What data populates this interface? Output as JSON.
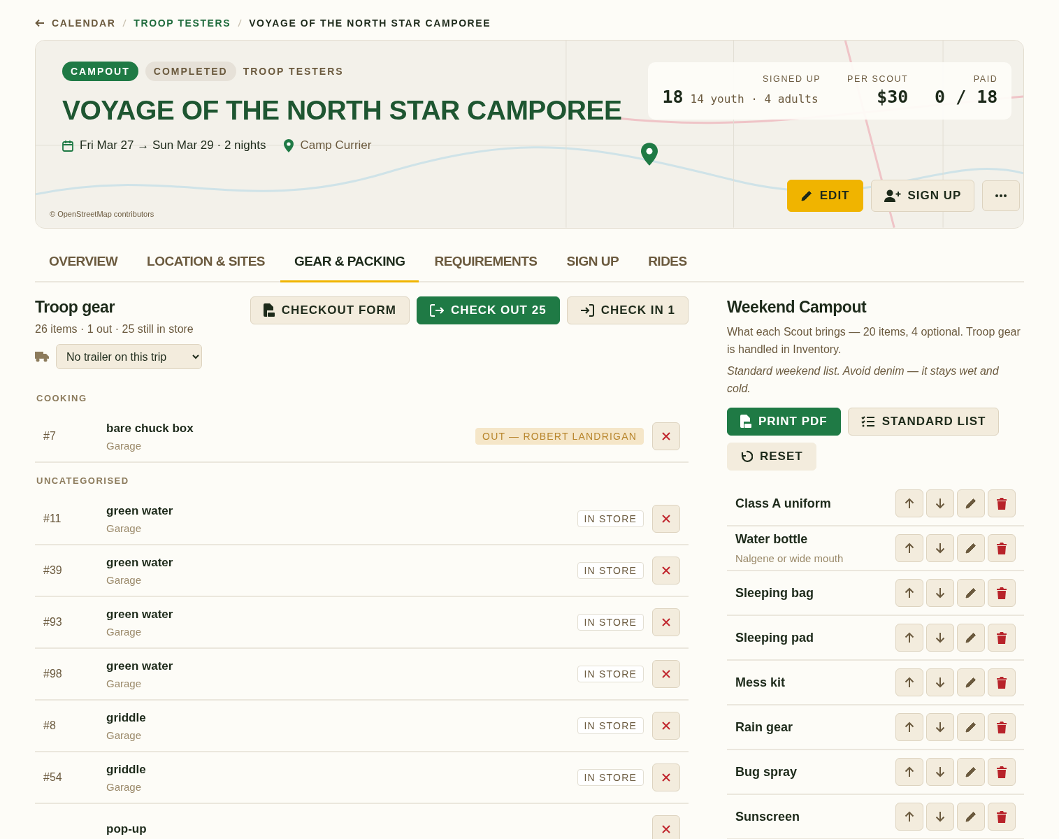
{
  "breadcrumb": [
    {
      "label": "CALENDAR",
      "kind": "back"
    },
    {
      "label": "TROOP TESTERS",
      "kind": "link"
    },
    {
      "label": "VOYAGE OF THE NORTH STAR CAMPOREE",
      "kind": "current"
    }
  ],
  "event": {
    "tags": [
      {
        "label": "CAMPOUT",
        "kind": "type"
      },
      {
        "label": "COMPLETED",
        "kind": "status"
      },
      {
        "label": "TROOP TESTERS",
        "kind": "unit"
      }
    ],
    "title": "VOYAGE OF THE NORTH STAR CAMPOREE",
    "dates": "Fri Mar 27 → Sun Mar 29 · 2 nights",
    "location": "Camp Currier",
    "map_credit": "© OpenStreetMap contributors",
    "stats": {
      "signed_up_label": "SIGNED UP",
      "signed_up": "18",
      "signed_up_detail": "14 youth · 4 adults",
      "per_scout_label": "PER SCOUT",
      "per_scout": "$30",
      "paid_label": "PAID",
      "paid": "0 / 18"
    },
    "actions": [
      {
        "label": "EDIT",
        "kind": "edit"
      },
      {
        "label": "SIGN UP",
        "kind": "signup"
      },
      {
        "kind": "more"
      }
    ]
  },
  "tabs": [
    {
      "label": "OVERVIEW",
      "selected": false
    },
    {
      "label": "LOCATION & SITES",
      "selected": false
    },
    {
      "label": "GEAR & PACKING",
      "selected": true
    },
    {
      "label": "REQUIREMENTS",
      "selected": false
    },
    {
      "label": "SIGN UP",
      "selected": false
    },
    {
      "label": "RIDES",
      "selected": false
    }
  ],
  "troop_gear": {
    "title": "Troop gear",
    "summary": "26 items · 1 out · 25 still in store",
    "trailer": "No trailer on this trip",
    "buttons": [
      {
        "label": "CHECKOUT FORM",
        "kind": "form"
      },
      {
        "label": "CHECK OUT 25",
        "kind": "checkout"
      },
      {
        "label": "CHECK IN 1",
        "kind": "checkin"
      }
    ],
    "categories": [
      {
        "name": "COOKING",
        "items": [
          {
            "number": "#7",
            "name": "bare chuck box",
            "location": "Garage",
            "status": "OUT — ROBERT LANDRIGAN",
            "kind": "out"
          }
        ]
      },
      {
        "name": "UNCATEGORISED",
        "items": [
          {
            "number": "#11",
            "name": "green water",
            "location": "Garage",
            "status": "IN STORE",
            "kind": "in_store"
          },
          {
            "number": "#39",
            "name": "green water",
            "location": "Garage",
            "status": "IN STORE",
            "kind": "in_store"
          },
          {
            "number": "#93",
            "name": "green water",
            "location": "Garage",
            "status": "IN STORE",
            "kind": "in_store"
          },
          {
            "number": "#98",
            "name": "green water",
            "location": "Garage",
            "status": "IN STORE",
            "kind": "in_store"
          },
          {
            "number": "#8",
            "name": "griddle",
            "location": "Garage",
            "status": "IN STORE",
            "kind": "in_store"
          },
          {
            "number": "#54",
            "name": "griddle",
            "location": "Garage",
            "status": "IN STORE",
            "kind": "in_store"
          },
          {
            "name": "pop-up"
          }
        ]
      }
    ]
  },
  "packing_list": {
    "title": "Weekend Campout",
    "description": "What each Scout brings — 20 items, 4 optional. Troop gear is handled in Inventory.",
    "note": "Standard weekend list. Avoid denim — it stays wet and cold.",
    "buttons": [
      {
        "label": "PRINT PDF",
        "kind": "pdf"
      },
      {
        "label": "STANDARD LIST",
        "kind": "list"
      },
      {
        "label": "RESET",
        "kind": "reset"
      }
    ],
    "items": [
      {
        "name": "Class A uniform"
      },
      {
        "name": "Water bottle",
        "note": "Nalgene or wide mouth"
      },
      {
        "name": "Sleeping bag"
      },
      {
        "name": "Sleeping pad"
      },
      {
        "name": "Mess kit"
      },
      {
        "name": "Rain gear"
      },
      {
        "name": "Bug spray"
      },
      {
        "name": "Sunscreen"
      }
    ]
  }
}
